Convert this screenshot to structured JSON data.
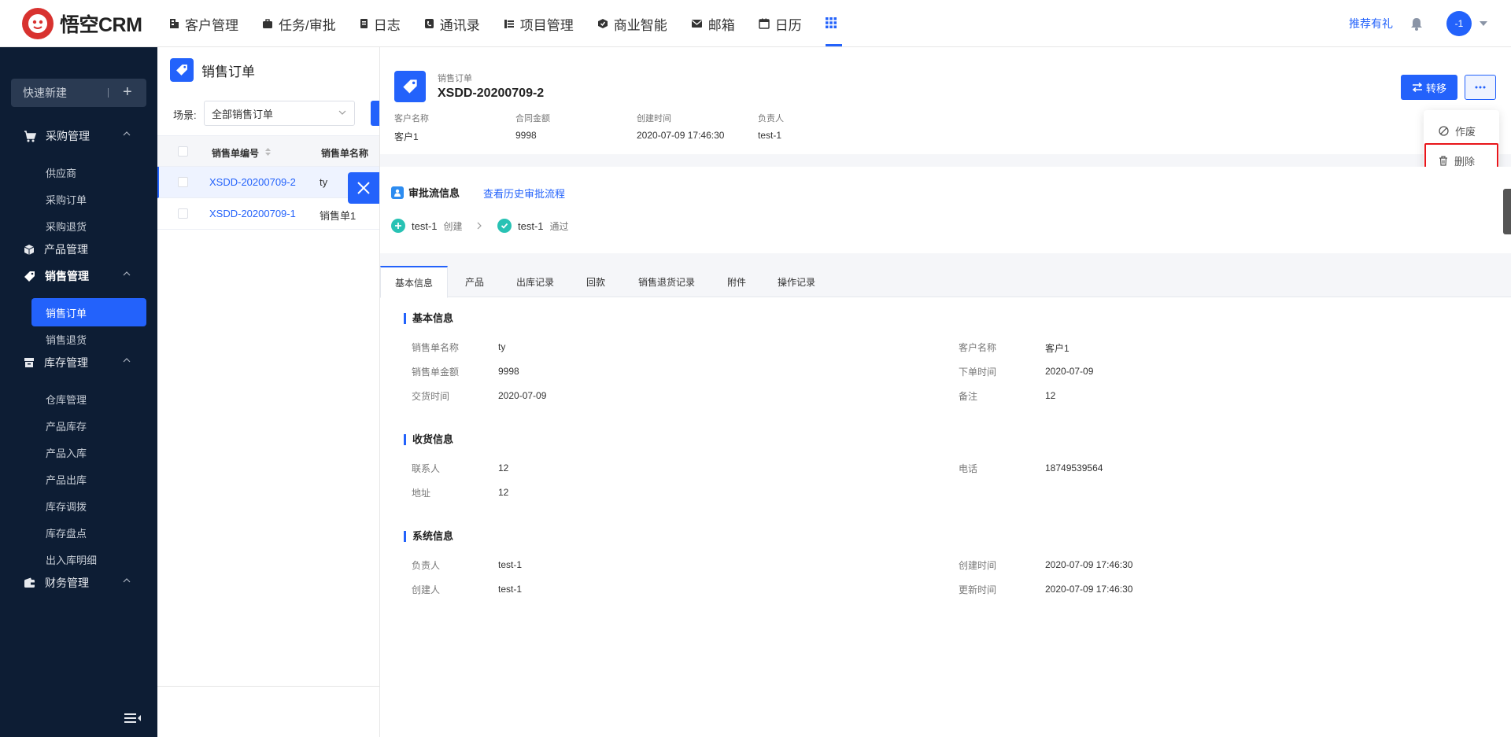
{
  "app": {
    "logo_text": "悟空CRM"
  },
  "nav": [
    {
      "label": "客户管理",
      "icon": "building-icon"
    },
    {
      "label": "任务/审批",
      "icon": "briefcase-icon"
    },
    {
      "label": "日志",
      "icon": "log-icon"
    },
    {
      "label": "通讯录",
      "icon": "phone-icon"
    },
    {
      "label": "项目管理",
      "icon": "project-icon"
    },
    {
      "label": "商业智能",
      "icon": "bi-icon"
    },
    {
      "label": "邮箱",
      "icon": "mail-icon"
    },
    {
      "label": "日历",
      "icon": "calendar-icon"
    }
  ],
  "topbar": {
    "recommend": "推荐有礼",
    "avatar": "-1"
  },
  "sidebar": {
    "quick_new": "快速新建",
    "groups": [
      {
        "label": "采购管理"
      },
      {
        "label": "产品管理"
      },
      {
        "label": "销售管理"
      },
      {
        "label": "库存管理"
      },
      {
        "label": "财务管理"
      }
    ],
    "purchase_items": [
      "供应商",
      "采购订单",
      "采购退货"
    ],
    "sales_items": [
      "销售订单",
      "销售退货"
    ],
    "stock_items": [
      "仓库管理",
      "产品库存",
      "产品入库",
      "产品出库",
      "库存调拨",
      "库存盘点",
      "出入库明细"
    ]
  },
  "list": {
    "title": "销售订单",
    "scene_label": "场景:",
    "scene_value": "全部销售订单",
    "columns": [
      "销售单编号",
      "销售单名称"
    ],
    "rows": [
      {
        "code": "XSDD-20200709-2",
        "name": "ty"
      },
      {
        "code": "XSDD-20200709-1",
        "name": "销售单1"
      }
    ]
  },
  "detail": {
    "type_label": "销售订单",
    "code": "XSDD-20200709-2",
    "summary": [
      {
        "label": "客户名称",
        "value": "客户1"
      },
      {
        "label": "合同金额",
        "value": "9998"
      },
      {
        "label": "创建时间",
        "value": "2020-07-09 17:46:30"
      },
      {
        "label": "负责人",
        "value": "test-1"
      }
    ],
    "transfer_label": "转移",
    "menu": {
      "void": "作废",
      "delete": "删除"
    },
    "approval": {
      "title": "审批流信息",
      "history_link": "查看历史审批流程",
      "steps": [
        {
          "user": "test-1",
          "action": "创建"
        },
        {
          "user": "test-1",
          "action": "通过"
        }
      ]
    },
    "tabs": [
      "基本信息",
      "产品",
      "出库记录",
      "回款",
      "销售退货记录",
      "附件",
      "操作记录"
    ],
    "sections": {
      "basic": {
        "title": "基本信息",
        "fields": [
          {
            "label": "销售单名称",
            "value": "ty"
          },
          {
            "label": "客户名称",
            "value": "客户1"
          },
          {
            "label": "销售单金额",
            "value": "9998"
          },
          {
            "label": "下单时间",
            "value": "2020-07-09"
          },
          {
            "label": "交货时间",
            "value": "2020-07-09"
          },
          {
            "label": "备注",
            "value": "12"
          }
        ]
      },
      "shipping": {
        "title": "收货信息",
        "fields": [
          {
            "label": "联系人",
            "value": "12"
          },
          {
            "label": "电话",
            "value": "18749539564"
          },
          {
            "label": "地址",
            "value": "12"
          }
        ]
      },
      "system": {
        "title": "系统信息",
        "fields": [
          {
            "label": "负责人",
            "value": "test-1"
          },
          {
            "label": "创建时间",
            "value": "2020-07-09 17:46:30"
          },
          {
            "label": "创建人",
            "value": "test-1"
          },
          {
            "label": "更新时间",
            "value": "2020-07-09 17:46:30"
          }
        ]
      }
    }
  },
  "colors": {
    "primary": "#2362fb",
    "sidebar": "#0d1d34",
    "highlight": "#e8151a",
    "logo": "#d8322f",
    "approval_ok": "#28c2b4"
  }
}
